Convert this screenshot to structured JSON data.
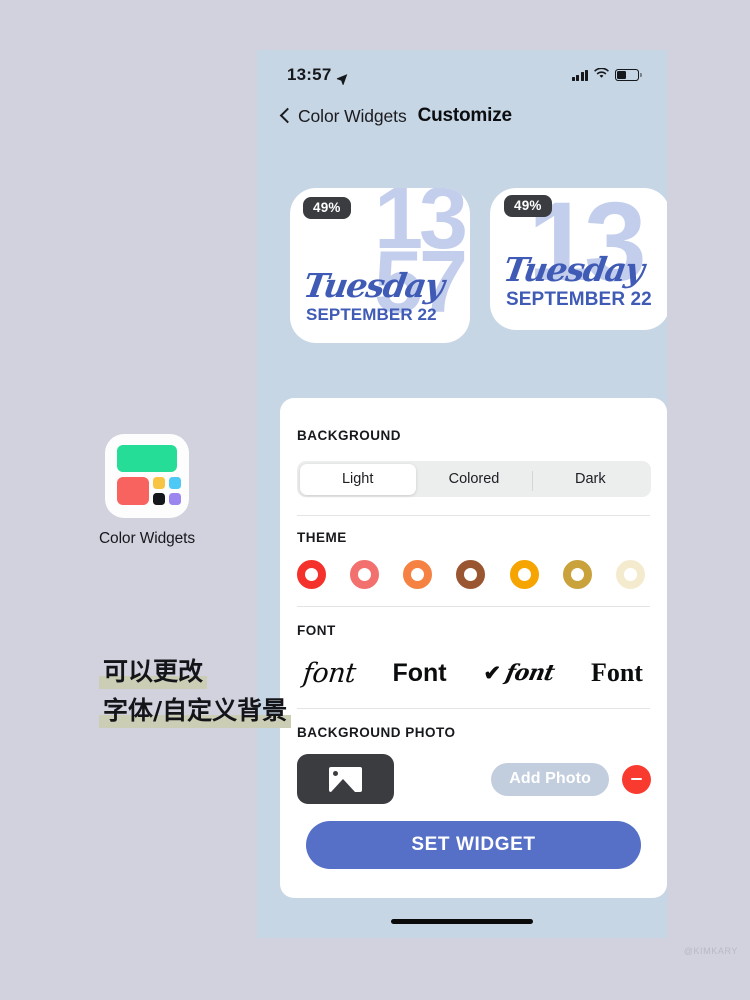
{
  "page": {
    "background_color": "#d2d2de",
    "watermark": "@KIMKARY"
  },
  "phone": {
    "background_color": "#c7d6e4",
    "status_bar": {
      "time": "13:57",
      "location_icon": "location-arrow-icon",
      "signal_icon": "cellular-signal-icon",
      "wifi_icon": "wifi-icon",
      "battery_icon": "battery-icon",
      "battery_level_percent": 44
    },
    "nav_bar": {
      "back_icon": "chevron-left-icon",
      "back_label": "Color Widgets",
      "title": "Customize"
    },
    "widget_previews": [
      {
        "battery_badge": "49%",
        "hour": "13",
        "minute": "57",
        "day_name": "Tuesday",
        "date_line": "SEPTEMBER 22",
        "text_color": "#3f5bb5",
        "numeral_color": "#c3cdec"
      },
      {
        "battery_badge": "49%",
        "hour": "13",
        "minute": "",
        "day_name": "Tuesday",
        "date_line": "SEPTEMBER 22",
        "text_color": "#3f5bb5",
        "numeral_color": "#c3cdec"
      }
    ],
    "sheet": {
      "background_section": {
        "label": "BACKGROUND",
        "options": [
          {
            "label": "Light",
            "selected": true
          },
          {
            "label": "Colored",
            "selected": false
          },
          {
            "label": "Dark",
            "selected": false
          }
        ]
      },
      "theme_section": {
        "label": "THEME",
        "swatches": [
          {
            "name": "red",
            "color": "#f4312b"
          },
          {
            "name": "salmon",
            "color": "#f2716e"
          },
          {
            "name": "orange",
            "color": "#f58243"
          },
          {
            "name": "brown",
            "color": "#9a5630"
          },
          {
            "name": "amber",
            "color": "#f5a400"
          },
          {
            "name": "olive-gold",
            "color": "#c9a23b"
          },
          {
            "name": "cream",
            "color": "#f4ebcf"
          }
        ]
      },
      "font_section": {
        "label": "FONT",
        "options": [
          {
            "sample": "font",
            "style": "script",
            "selected": false
          },
          {
            "sample": "Font",
            "style": "sans-bold",
            "selected": false
          },
          {
            "sample": "font",
            "style": "script-bold",
            "selected": true,
            "check": "✔"
          },
          {
            "sample": "Font",
            "style": "serif-bold",
            "selected": false
          }
        ]
      },
      "background_photo_section": {
        "label": "BACKGROUND PHOTO",
        "thumbnail_icon": "photo-placeholder-icon",
        "add_photo_label": "Add Photo",
        "remove_icon": "minus-icon",
        "remove_color": "#f93a2f"
      },
      "set_widget_label": "SET WIDGET",
      "set_widget_color": "#5570c6"
    },
    "home_indicator": "home-indicator"
  },
  "app_shortcut": {
    "icon_name": "color-widgets-app-icon",
    "label": "Color Widgets",
    "tile_colors": {
      "green": "#25dd96",
      "red": "#f9635f",
      "yellow": "#f8c542",
      "blue": "#4ec8f5",
      "black": "#16171b",
      "purple": "#9b86f0"
    }
  },
  "annotation": {
    "line1": "可以更改",
    "line2": "字体/自定义背景",
    "highlight_color": "#cbcdb5"
  }
}
